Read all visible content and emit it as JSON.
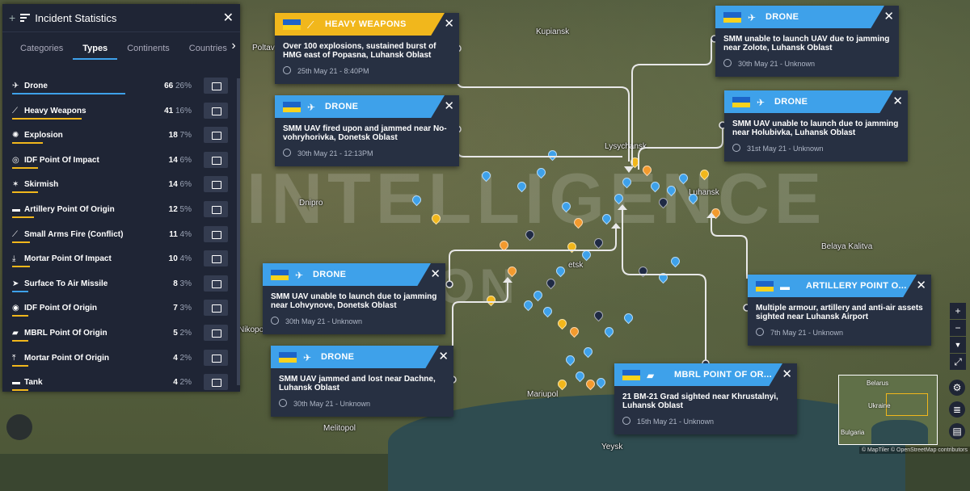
{
  "panel": {
    "title": "Incident Statistics",
    "tabs": [
      "Categories",
      "Types",
      "Continents",
      "Countries"
    ],
    "active_tab": "Types",
    "rows": [
      {
        "icon": "drone-icon",
        "label": "Drone",
        "count": "66",
        "pct": "26%",
        "color": "#3ea1ea",
        "share": 0.26
      },
      {
        "icon": "heavy-weapons-icon",
        "label": "Heavy Weapons",
        "count": "41",
        "pct": "16%",
        "color": "#f1b71c",
        "share": 0.16
      },
      {
        "icon": "explosion-icon",
        "label": "Explosion",
        "count": "18",
        "pct": "7%",
        "color": "#f1b71c",
        "share": 0.07
      },
      {
        "icon": "idf-impact-icon",
        "label": "IDF Point Of Impact",
        "count": "14",
        "pct": "6%",
        "color": "#f1b71c",
        "share": 0.06
      },
      {
        "icon": "skirmish-icon",
        "label": "Skirmish",
        "count": "14",
        "pct": "6%",
        "color": "#f1b71c",
        "share": 0.06
      },
      {
        "icon": "artillery-icon",
        "label": "Artillery Point Of Origin",
        "count": "12",
        "pct": "5%",
        "color": "#f1b71c",
        "share": 0.05
      },
      {
        "icon": "small-arms-icon",
        "label": "Small Arms Fire (Conflict)",
        "count": "11",
        "pct": "4%",
        "color": "#f1b71c",
        "share": 0.04
      },
      {
        "icon": "mortar-impact-icon",
        "label": "Mortar Point Of Impact",
        "count": "10",
        "pct": "4%",
        "color": "#f1b71c",
        "share": 0.04
      },
      {
        "icon": "missile-icon",
        "label": "Surface To Air Missile",
        "count": "8",
        "pct": "3%",
        "color": "#3ea1ea",
        "share": 0.03
      },
      {
        "icon": "idf-origin-icon",
        "label": "IDF Point Of Origin",
        "count": "7",
        "pct": "3%",
        "color": "#f1b71c",
        "share": 0.03
      },
      {
        "icon": "mbrl-icon",
        "label": "MBRL Point Of Origin",
        "count": "5",
        "pct": "2%",
        "color": "#f1b71c",
        "share": 0.02
      },
      {
        "icon": "mortar-origin-icon",
        "label": "Mortar Point Of Origin",
        "count": "4",
        "pct": "2%",
        "color": "#f1b71c",
        "share": 0.02
      },
      {
        "icon": "tank-icon",
        "label": "Tank",
        "count": "4",
        "pct": "2%",
        "color": "#f1b71c",
        "share": 0.02
      }
    ]
  },
  "popups": [
    {
      "type": "HEAVY WEAPONS",
      "theme": "#f1b71c",
      "icon": "heavy-weapons-icon",
      "text": "Over 100 explosions, sustained burst of HMG east of Popasna, Luhansk Oblast",
      "time": "25th May 21 - 8:40PM"
    },
    {
      "type": "DRONE",
      "theme": "#3ea1ea",
      "icon": "drone-icon",
      "text": "SMM UAV fired upon and jammed near No-vohryhorivka, Donetsk Oblast",
      "time": "30th May 21 - 12:13PM"
    },
    {
      "type": "DRONE",
      "theme": "#3ea1ea",
      "icon": "drone-icon",
      "text": "SMM UAV unable to launch due to jamming near Lohvynove, Donetsk Oblast",
      "time": "30th May 21 - Unknown"
    },
    {
      "type": "DRONE",
      "theme": "#3ea1ea",
      "icon": "drone-icon",
      "text": "SMM UAV jammed and lost near Dachne, Luhansk Oblast",
      "time": "30th May 21 - Unknown"
    },
    {
      "type": "DRONE",
      "theme": "#3ea1ea",
      "icon": "drone-icon",
      "text": "SMM unable to launch UAV due to jamming near Zolote, Luhansk Oblast",
      "time": "30th May 21 - Unknown"
    },
    {
      "type": "DRONE",
      "theme": "#3ea1ea",
      "icon": "drone-icon",
      "text": "SMM UAV unable to launch due to jamming near Holubivka, Luhansk Oblast",
      "time": "31st May 21 - Unknown"
    },
    {
      "type": "ARTILLERY POINT O...",
      "theme": "#3ea1ea",
      "icon": "artillery-icon",
      "text": "Multiple armour, artillery and anti-air assets sighted near Luhansk Airport",
      "time": "7th May 21 - Unknown"
    },
    {
      "type": "MBRL POINT OF OR...",
      "theme": "#3ea1ea",
      "icon": "mbrl-icon",
      "text": "21 BM-21 Grad sighted near Khrustalnyi, Luhansk Oblast",
      "time": "15th May 21 - Unknown"
    }
  ],
  "map": {
    "cities": [
      "Kupiansk",
      "Poltav",
      "Lysychansk",
      "Luhansk",
      "Dnipro",
      "Belaya Kalitva",
      "Mariupol",
      "Melitopol",
      "Nikopol",
      "Yeysk",
      "etsk"
    ],
    "watermark": "INTELLIGENCE",
    "watermark2": "FUSION"
  },
  "minimap": {
    "labels": [
      "Belarus",
      "Ukraine",
      "Bulgaria"
    ]
  },
  "controls": {
    "zoom_in": "+",
    "zoom_out": "−",
    "reset": "▼",
    "fullscreen": "⤢"
  },
  "attribution": "© MapTiler © OpenStreetMap contributors"
}
